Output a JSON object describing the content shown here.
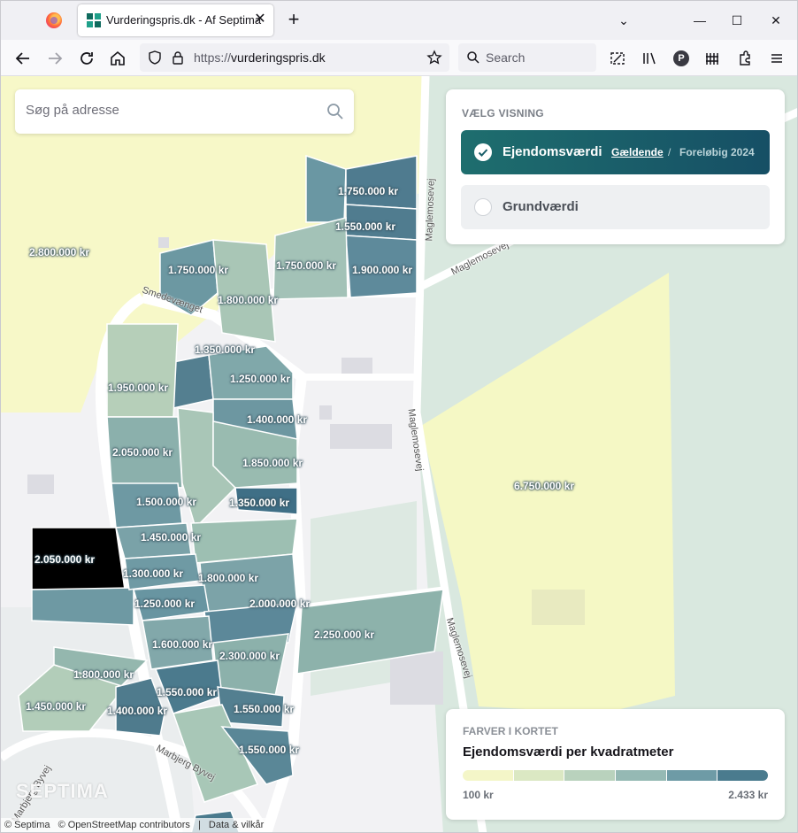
{
  "browser": {
    "tab_title": "Vurderingspris.dk - Af Septima",
    "url_prefix": "https://",
    "url_host": "vurderingspris.dk",
    "search_placeholder": "Search"
  },
  "map_search": {
    "placeholder": "Søg på adresse"
  },
  "view_panel": {
    "title": "VÆLG VISNING",
    "options": [
      {
        "label": "Ejendomsværdi",
        "selected": true,
        "current_link": "Gældende",
        "separator": "/",
        "preliminary": "Foreløbig 2024"
      },
      {
        "label": "Grundværdi",
        "selected": false
      }
    ]
  },
  "legend": {
    "title": "FARVER I KORTET",
    "subtitle": "Ejendomsværdi per kvadratmeter",
    "min": "100 kr",
    "max": "2.433 kr",
    "colors": [
      "#f4f6c8",
      "#dbe8c3",
      "#b9d2bd",
      "#95b9b4",
      "#6e9ba6",
      "#4a7b8e"
    ]
  },
  "roads": [
    "Smedevænget",
    "Maglemosevej",
    "Maglemosevej",
    "Maglemosevej",
    "Maglemosevej",
    "Marbjerg Byvej",
    "Marbjerg Byvej"
  ],
  "prices": [
    "1.750.000 kr",
    "1.550.000 kr",
    "1.900.000 kr",
    "2.800.000 kr",
    "1.750.000 kr",
    "1.750.000 kr",
    "1.800.000 kr",
    "1.350.000 kr",
    "1.950.000 kr",
    "1.250.000 kr",
    "1.400.000 kr",
    "2.050.000 kr",
    "1.850.000 kr",
    "1.500.000 kr",
    "1.350.000 kr",
    "6.750.000 kr",
    "1.450.000 kr",
    "2.050.000 kr",
    "1.300.000 kr",
    "1.800.000 kr",
    "1.250.000 kr",
    "2.000.000 kr",
    "2.250.000 kr",
    "1.600.000 kr",
    "2.300.000 kr",
    "1.800.000 kr",
    "1.550.000 kr",
    "1.450.000 kr",
    "1.400.000 kr",
    "1.550.000 kr",
    "1.550.000 kr"
  ],
  "attribution": [
    "© Septima",
    "© OpenStreetMap contributors",
    "|",
    "Data & vilkår"
  ],
  "brand": "SEPTIMA",
  "colors": {
    "accent": "#1b5f6a",
    "panel_bg": "#ffffff"
  }
}
